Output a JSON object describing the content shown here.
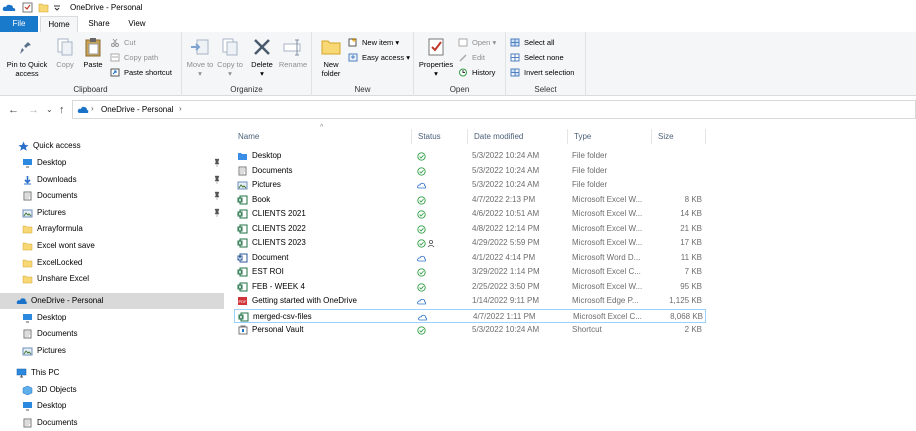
{
  "window": {
    "title": "OneDrive - Personal"
  },
  "tabs": {
    "file": "File",
    "home": "Home",
    "share": "Share",
    "view": "View"
  },
  "ribbon": {
    "clipboard": {
      "label": "Clipboard",
      "pin": "Pin to Quick access",
      "copy": "Copy",
      "paste": "Paste",
      "cut": "Cut",
      "copy_path": "Copy path",
      "paste_shortcut": "Paste shortcut"
    },
    "organize": {
      "label": "Organize",
      "move_to": "Move to",
      "copy_to": "Copy to",
      "delete": "Delete",
      "rename": "Rename"
    },
    "new": {
      "label": "New",
      "new_folder": "New folder",
      "new_item": "New item",
      "easy_access": "Easy access"
    },
    "open": {
      "label": "Open",
      "properties": "Properties",
      "open": "Open",
      "edit": "Edit",
      "history": "History"
    },
    "select": {
      "label": "Select",
      "select_all": "Select all",
      "select_none": "Select none",
      "invert": "Invert selection"
    }
  },
  "address": {
    "crumb": "OneDrive - Personal"
  },
  "nav": {
    "quick_access": "Quick access",
    "quick_items": [
      "Desktop",
      "Downloads",
      "Documents",
      "Pictures",
      "Arrayformula",
      "Excel wont save",
      "ExcelLocked",
      "Unshare Excel"
    ],
    "onedrive": "OneDrive - Personal",
    "onedrive_items": [
      "Desktop",
      "Documents",
      "Pictures"
    ],
    "this_pc": "This PC",
    "pc_items": [
      "3D Objects",
      "Desktop",
      "Documents"
    ]
  },
  "columns": {
    "name": "Name",
    "status": "Status",
    "date": "Date modified",
    "type": "Type",
    "size": "Size"
  },
  "files": [
    {
      "name": "Desktop",
      "date": "5/3/2022 10:24 AM",
      "type": "File folder",
      "size": "",
      "icon": "folder-blue-icon",
      "status": "synced"
    },
    {
      "name": "Documents",
      "date": "5/3/2022 10:24 AM",
      "type": "File folder",
      "size": "",
      "icon": "documents-folder-icon",
      "status": "synced"
    },
    {
      "name": "Pictures",
      "date": "5/3/2022 10:24 AM",
      "type": "File folder",
      "size": "",
      "icon": "pictures-folder-icon",
      "status": "cloud"
    },
    {
      "name": "Book",
      "date": "4/7/2022 2:13 PM",
      "type": "Microsoft Excel W...",
      "size": "8 KB",
      "icon": "excel-icon",
      "status": "synced"
    },
    {
      "name": "CLIENTS 2021",
      "date": "4/6/2022 10:51 AM",
      "type": "Microsoft Excel W...",
      "size": "14 KB",
      "icon": "excel-icon",
      "status": "synced"
    },
    {
      "name": "CLIENTS 2022",
      "date": "4/8/2022 12:14 PM",
      "type": "Microsoft Excel W...",
      "size": "21 KB",
      "icon": "excel-icon",
      "status": "synced"
    },
    {
      "name": "CLIENTS 2023",
      "date": "4/29/2022 5:59 PM",
      "type": "Microsoft Excel W...",
      "size": "17 KB",
      "icon": "excel-icon",
      "status": "shared"
    },
    {
      "name": "Document",
      "date": "4/1/2022 4:14 PM",
      "type": "Microsoft Word D...",
      "size": "11 KB",
      "icon": "word-icon",
      "status": "cloud"
    },
    {
      "name": "EST ROI",
      "date": "3/29/2022 1:14 PM",
      "type": "Microsoft Excel C...",
      "size": "7 KB",
      "icon": "excel-icon",
      "status": "synced"
    },
    {
      "name": "FEB - WEEK 4",
      "date": "2/25/2022 3:50 PM",
      "type": "Microsoft Excel W...",
      "size": "95 KB",
      "icon": "excel-icon",
      "status": "synced"
    },
    {
      "name": "Getting started with OneDrive",
      "date": "1/14/2022 9:11 PM",
      "type": "Microsoft Edge P...",
      "size": "1,125 KB",
      "icon": "pdf-icon",
      "status": "cloud"
    },
    {
      "name": "merged-csv-files",
      "date": "4/7/2022 1:11 PM",
      "type": "Microsoft Excel C...",
      "size": "8,068 KB",
      "icon": "excel-icon",
      "status": "cloud"
    },
    {
      "name": "Personal Vault",
      "date": "5/3/2022 10:24 AM",
      "type": "Shortcut",
      "size": "2 KB",
      "icon": "vault-icon",
      "status": "synced"
    }
  ],
  "colors": {
    "accent": "#1979ca",
    "synced": "#2f9e44",
    "cloud": "#2b70c9",
    "excel": "#1d7044",
    "word": "#2b579a",
    "pdf": "#d13438",
    "folder": "#f8d775"
  }
}
